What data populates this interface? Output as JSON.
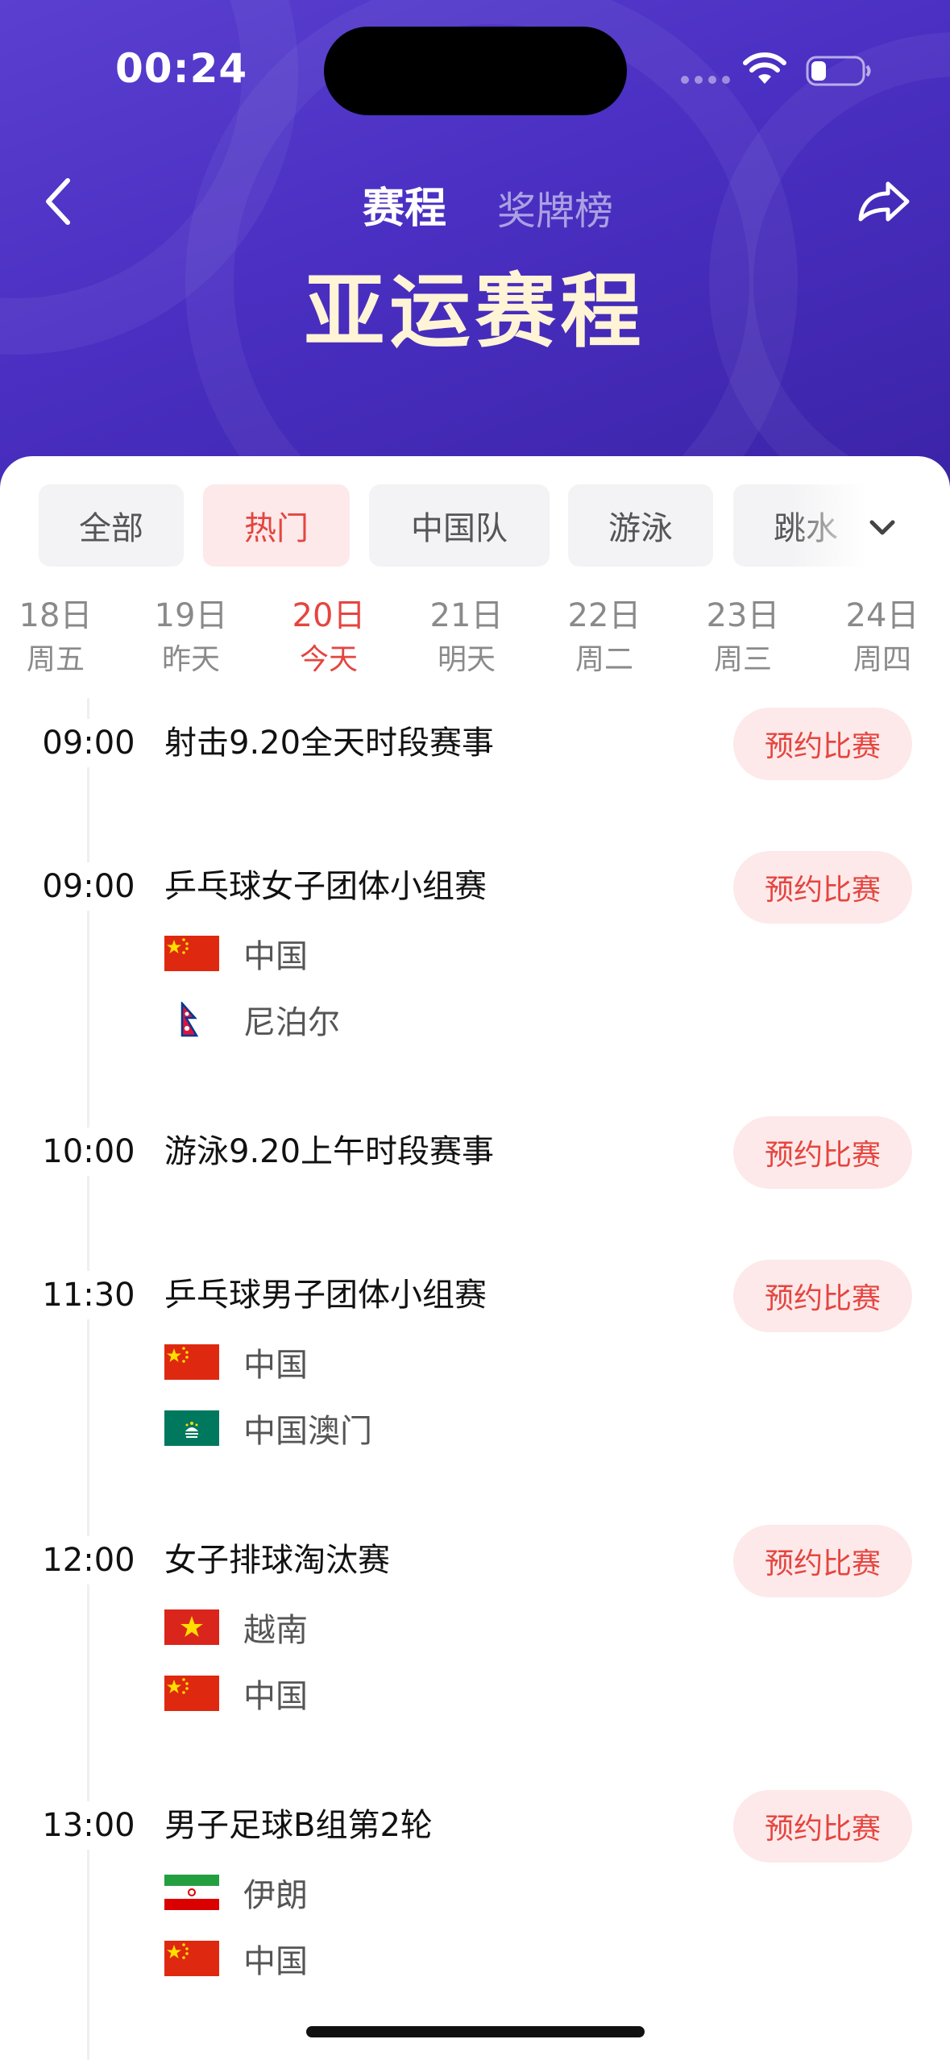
{
  "status_bar": {
    "time": "00:24"
  },
  "header": {
    "tab_schedule": "赛程",
    "tab_medals": "奖牌榜",
    "title": "亚运赛程"
  },
  "filters": [
    {
      "label": "全部",
      "active": false
    },
    {
      "label": "热门",
      "active": true
    },
    {
      "label": "中国队",
      "active": false
    },
    {
      "label": "游泳",
      "active": false
    },
    {
      "label": "跳水",
      "active": false
    }
  ],
  "dates": [
    {
      "day": "18日",
      "week": "周五",
      "active": false
    },
    {
      "day": "19日",
      "week": "昨天",
      "active": false
    },
    {
      "day": "20日",
      "week": "今天",
      "active": true
    },
    {
      "day": "21日",
      "week": "明天",
      "active": false
    },
    {
      "day": "22日",
      "week": "周二",
      "active": false
    },
    {
      "day": "23日",
      "week": "周三",
      "active": false
    },
    {
      "day": "24日",
      "week": "周四",
      "active": false
    }
  ],
  "reserve_label": "预约比赛",
  "events": [
    {
      "time": "09:00",
      "title": "射击9.20全天时段赛事",
      "teams": []
    },
    {
      "time": "09:00",
      "title": "乒乓球女子团体小组赛",
      "teams": [
        {
          "name": "中国",
          "flag": "china-flag-icon"
        },
        {
          "name": "尼泊尔",
          "flag": "nepal-flag-icon"
        }
      ]
    },
    {
      "time": "10:00",
      "title": "游泳9.20上午时段赛事",
      "teams": []
    },
    {
      "time": "11:30",
      "title": "乒乓球男子团体小组赛",
      "teams": [
        {
          "name": "中国",
          "flag": "china-flag-icon"
        },
        {
          "name": "中国澳门",
          "flag": "macau-flag-icon"
        }
      ]
    },
    {
      "time": "12:00",
      "title": "女子排球淘汰赛",
      "teams": [
        {
          "name": "越南",
          "flag": "vietnam-flag-icon"
        },
        {
          "name": "中国",
          "flag": "china-flag-icon"
        }
      ]
    },
    {
      "time": "13:00",
      "title": "男子足球B组第2轮",
      "teams": [
        {
          "name": "伊朗",
          "flag": "iran-flag-icon"
        },
        {
          "name": "中国",
          "flag": "china-flag-icon"
        }
      ]
    }
  ],
  "colors": {
    "accent": "#e5453f",
    "header": "#4a2fc2",
    "title": "#fff4d6"
  }
}
